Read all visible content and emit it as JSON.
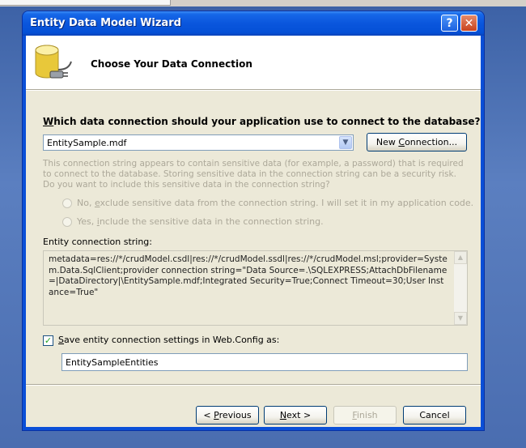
{
  "window": {
    "title": "Entity Data Model Wizard",
    "help_glyph": "?",
    "close_glyph": "✕"
  },
  "header": {
    "title": "Choose Your Data Connection",
    "icon": "database-plug-icon"
  },
  "connection": {
    "question_pre": "",
    "question_accel": "W",
    "question_post": "hich data connection should your application use to connect to the database?",
    "selected": "EntitySample.mdf",
    "new_connection_pre": "New ",
    "new_connection_accel": "C",
    "new_connection_post": "onnection..."
  },
  "sensitive": {
    "warning": "This connection string appears to contain sensitive data (for example, a password) that is required to connect to the database. Storing sensitive data in the connection string can be a security risk. Do you want to include this sensitive data in the connection string?",
    "option_no_pre": "No, ",
    "option_no_accel": "e",
    "option_no_post": "xclude sensitive data from the connection string. I will set it in my application code.",
    "option_yes_pre": "Yes, ",
    "option_yes_accel": "i",
    "option_yes_post": "nclude the sensitive data in the connection string."
  },
  "entity": {
    "label": "Entity connection string:",
    "value": "metadata=res://*/crudModel.csdl|res://*/crudModel.ssdl|res://*/crudModel.msl;provider=System.Data.SqlClient;provider connection string=\"Data Source=.\\SQLEXPRESS;AttachDbFilename=|DataDirectory|\\EntitySample.mdf;Integrated Security=True;Connect Timeout=30;User Instance=True\""
  },
  "save": {
    "checked_glyph": "✓",
    "label_accel": "S",
    "label_post": "ave entity connection settings in Web.Config as:",
    "value": "EntitySampleEntities"
  },
  "buttons": {
    "previous_pre": "< ",
    "previous_accel": "P",
    "previous_post": "revious",
    "next_accel": "N",
    "next_post": "ext >",
    "finish_accel": "F",
    "finish_post": "inish",
    "cancel": "Cancel"
  },
  "colors": {
    "titlebar": "#0a56dd",
    "dialog_face": "#ece9d8",
    "checkbox_check": "#21a121"
  }
}
